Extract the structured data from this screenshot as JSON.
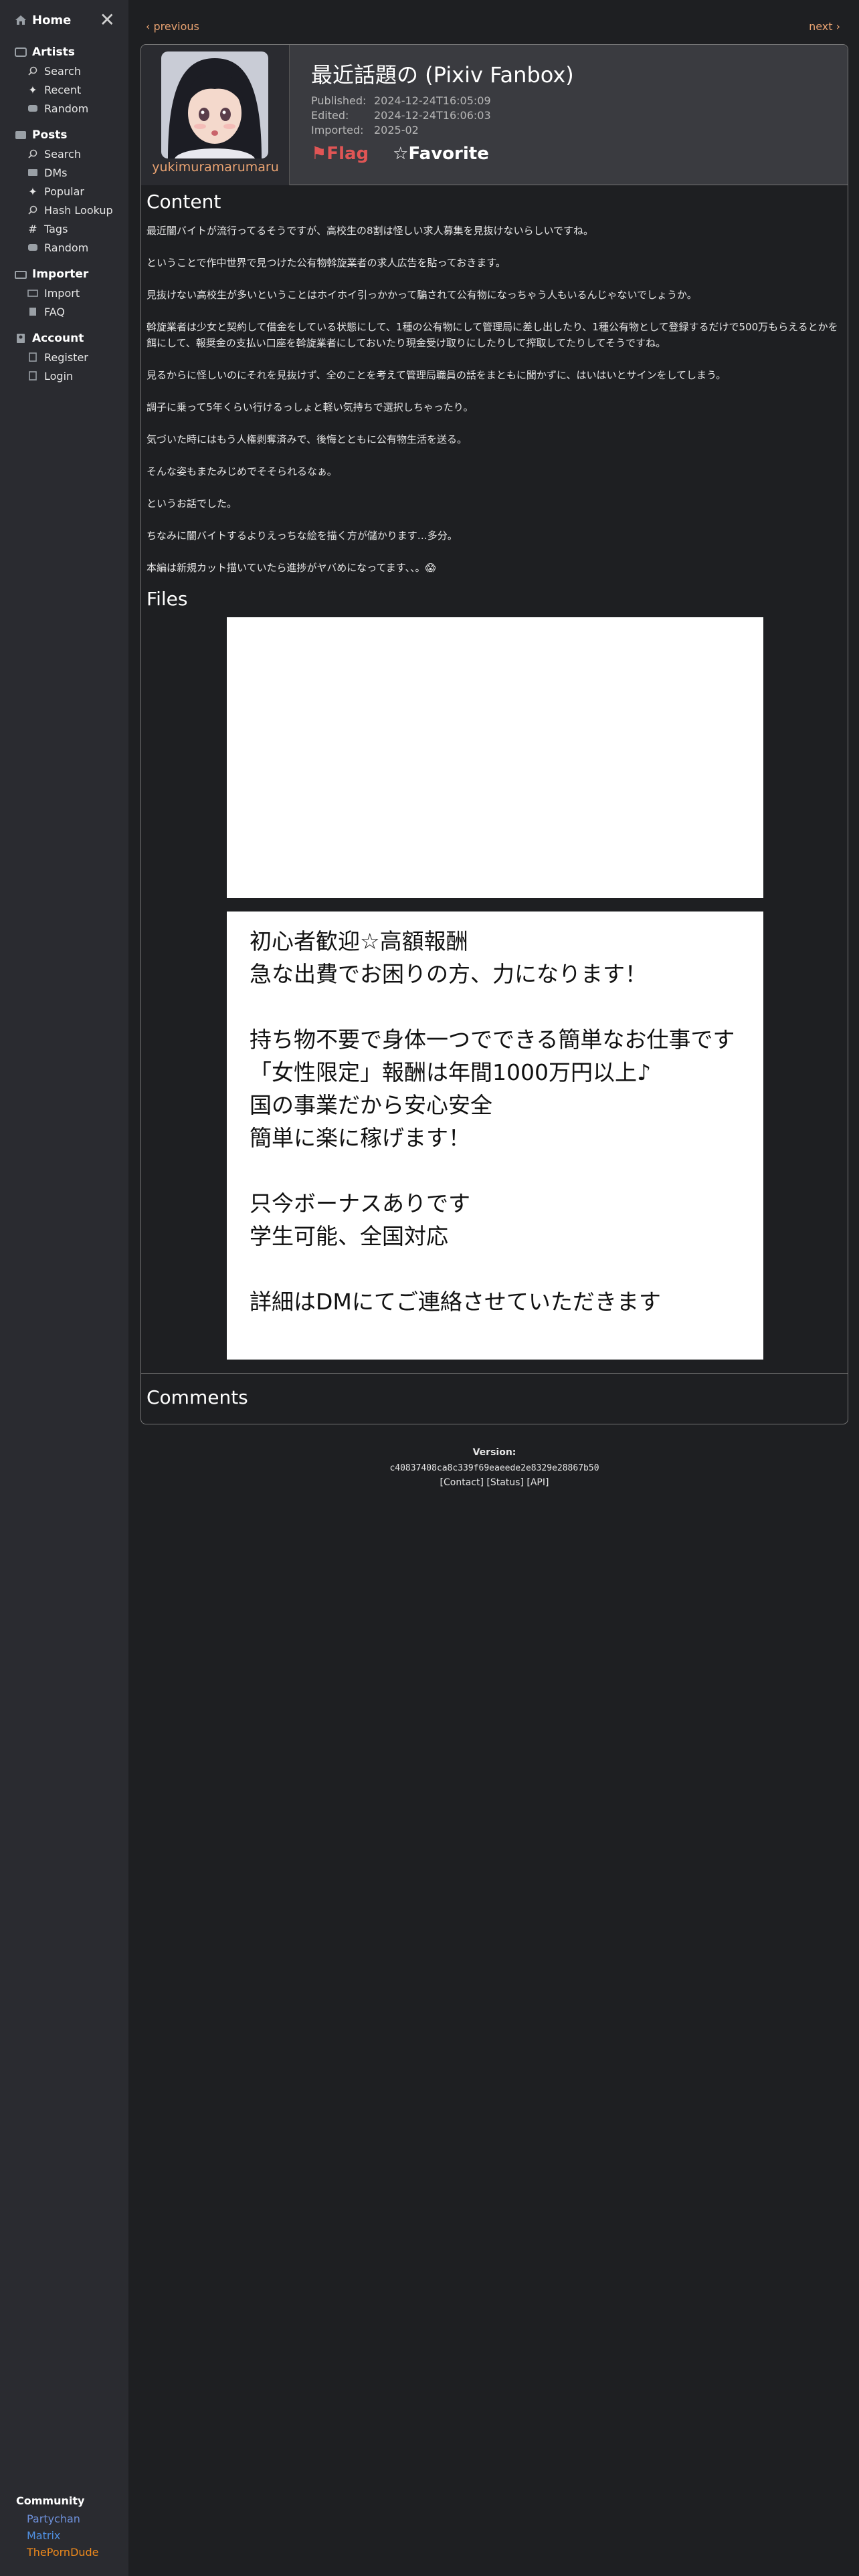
{
  "sidebar": {
    "home_label": "Home",
    "artists": {
      "title": "Artists",
      "items": [
        {
          "label": "Search",
          "icon": "search-icon"
        },
        {
          "label": "Recent",
          "icon": "sparkle-icon"
        },
        {
          "label": "Random",
          "icon": "dice-icon"
        }
      ]
    },
    "posts": {
      "title": "Posts",
      "items": [
        {
          "label": "Search",
          "icon": "search-icon"
        },
        {
          "label": "DMs",
          "icon": "mail-icon"
        },
        {
          "label": "Popular",
          "icon": "sparkle-icon"
        },
        {
          "label": "Hash Lookup",
          "icon": "search-icon"
        },
        {
          "label": "Tags",
          "icon": "hash-icon"
        },
        {
          "label": "Random",
          "icon": "dice-icon"
        }
      ]
    },
    "importer": {
      "title": "Importer",
      "items": [
        {
          "label": "Import",
          "icon": "import-icon"
        },
        {
          "label": "FAQ",
          "icon": "faq-icon"
        }
      ]
    },
    "account": {
      "title": "Account",
      "items": [
        {
          "label": "Register",
          "icon": "register-icon"
        },
        {
          "label": "Login",
          "icon": "login-icon"
        }
      ]
    },
    "community": {
      "title": "Community",
      "links": [
        {
          "label": "Partychan",
          "color": "#6d8fd8"
        },
        {
          "label": "Matrix",
          "color": "#4f8fe0"
        },
        {
          "label": "ThePornDude",
          "color": "#f08a1c"
        }
      ]
    }
  },
  "paginator": {
    "previous": "‹ previous",
    "next": "next ›"
  },
  "post": {
    "username": "yukimuramarumaru",
    "title": "最近話題の (Pixiv Fanbox)",
    "published_label": "Published:",
    "published": "2024-12-24T16:05:09",
    "edited_label": "Edited:",
    "edited": "2024-12-24T16:06:03",
    "imported_label": "Imported:",
    "imported": "2025-02",
    "flag_label": "⚑Flag",
    "favorite_label": "☆Favorite",
    "content_title": "Content",
    "paragraphs": [
      "最近闇バイトが流行ってるそうですが、高校生の8割は怪しい求人募集を見抜けないらしいですね。",
      "ということで作中世界で見つけた公有物斡旋業者の求人広告を貼っておきます。",
      "見抜けない高校生が多いということはホイホイ引っかかって騙されて公有物になっちゃう人もいるんじゃないでしょうか。",
      "斡旋業者は少女と契約して借金をしている状態にして、1種の公有物にして管理局に差し出したり、1種公有物として登録するだけで500万もらえるとかを餌にして、報奨金の支払い口座を斡旋業者にしておいたり現金受け取りにしたりして搾取してたりしてそうですね。",
      "見るからに怪しいのにそれを見抜けず、全のことを考えて管理局職員の話をまともに聞かずに、はいはいとサインをしてしまう。",
      "調子に乗って5年くらい行けるっしょと軽い気持ちで選択しちゃったり。",
      "気づいた時にはもう人権剥奪済みで、後悔とともに公有物生活を送る。",
      "そんな姿もまたみじめでそそられるなぁ。",
      "というお話でした。",
      "ちなみに闇バイトするよりえっちな絵を描く方が儲かります…多分。",
      "本編は新規カット描いていたら進捗がヤバめになってます、、。😱"
    ],
    "files_title": "Files",
    "ad_lines": [
      "初心者歓迎☆高額報酬",
      "急な出費でお困りの方、力になります！",
      "",
      "持ち物不要で身体一つでできる簡単なお仕事です",
      "「女性限定」報酬は年間1000万円以上♪",
      "国の事業だから安心安全",
      "簡単に楽に稼げます！",
      "",
      "只今ボーナスありです",
      "学生可能、全国対応",
      "",
      "詳細はDMにてご連絡させていただきます"
    ],
    "comments_title": "Comments"
  },
  "footer": {
    "version_label": "Version:",
    "version_hash": "c40837408ca8c339f69eaeede2e8329e28867b50",
    "links": "[Contact] [Status] [API]"
  },
  "colors": {
    "accent": "#e8a271",
    "background": "#1e1f22",
    "sidebar": "#2a2b30"
  }
}
